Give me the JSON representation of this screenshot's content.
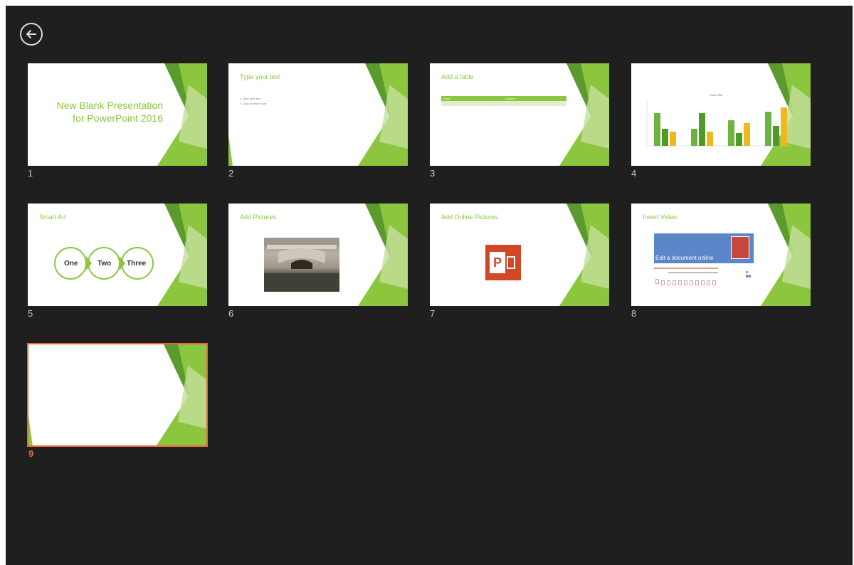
{
  "nav": {
    "back_icon": "arrow-left-icon"
  },
  "slides": [
    {
      "number": "1",
      "title": "New Blank Presentation for PowerPoint 2016",
      "title_line1": "New Blank Presentation",
      "title_line2": "for PowerPoint 2016"
    },
    {
      "number": "2",
      "title": "Type your text",
      "bullets": [
        "Type your text",
        "Click to learn more"
      ]
    },
    {
      "number": "3",
      "title": "Add a table",
      "table_headers": [
        "Head",
        "Column"
      ]
    },
    {
      "number": "4",
      "title": "",
      "chart_caption": "Chart Title"
    },
    {
      "number": "5",
      "title": "Smart Art",
      "smartart": [
        "One",
        "Two",
        "Three"
      ]
    },
    {
      "number": "6",
      "title": "Add Pictures"
    },
    {
      "number": "7",
      "title": "Add Online Pictures",
      "icon": "powerpoint-icon",
      "icon_letter": "P"
    },
    {
      "number": "8",
      "title": "Insert Video",
      "video_banner": "Edit a document online"
    },
    {
      "number": "9",
      "title": "",
      "selected": true
    }
  ],
  "colors": {
    "background": "#1f1f1f",
    "accent_green": "#8cc63f",
    "selection": "#e8663a"
  }
}
